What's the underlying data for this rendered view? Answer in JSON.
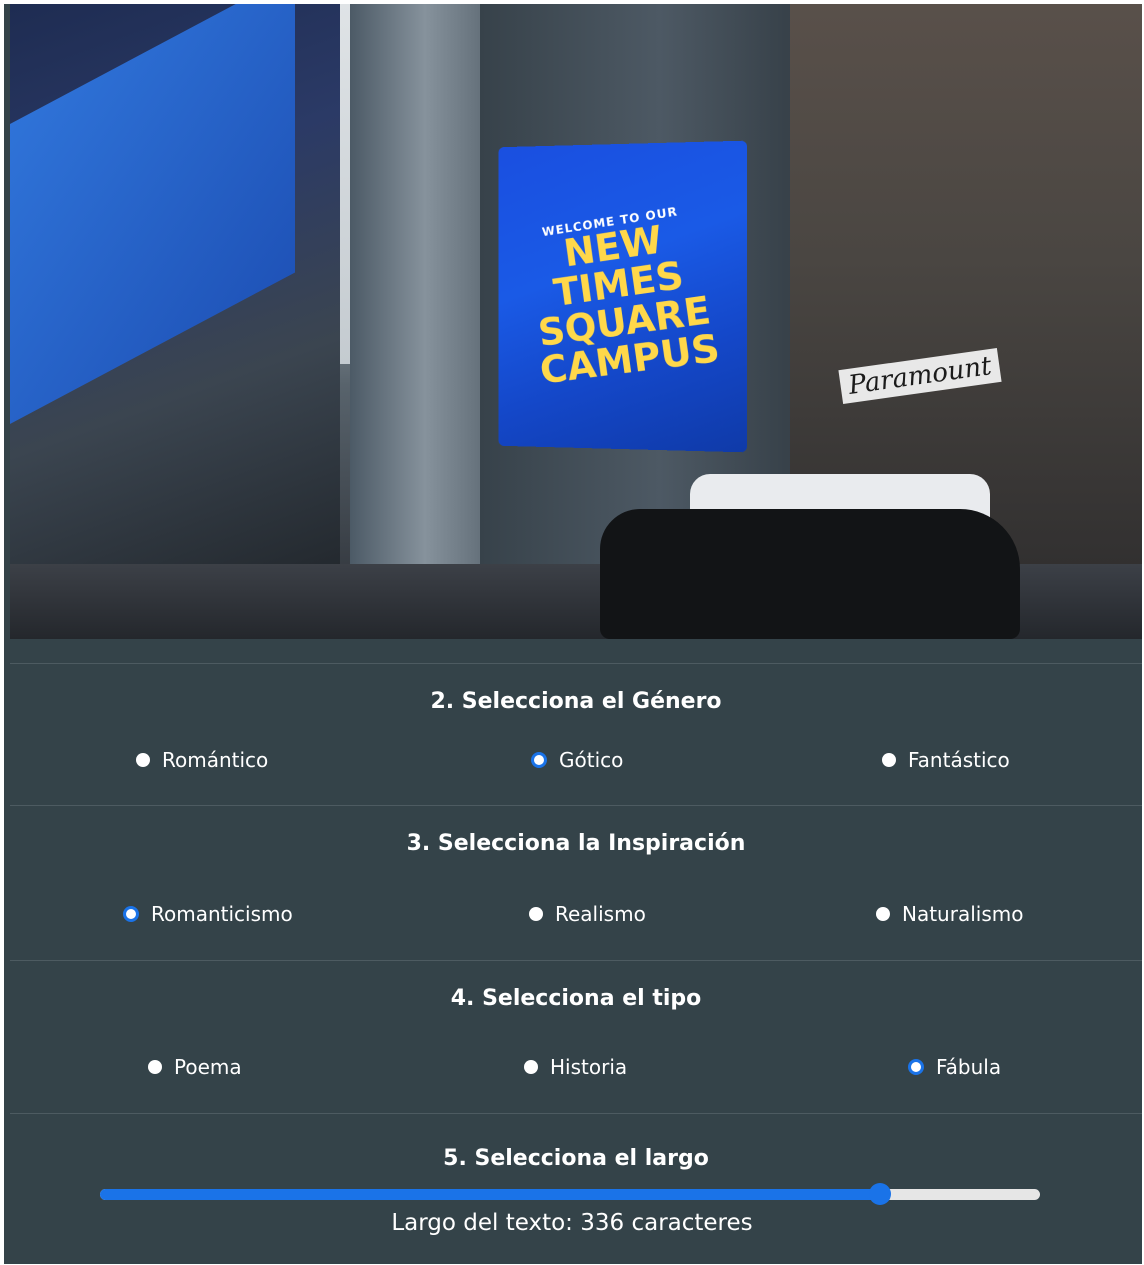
{
  "genre": {
    "title": "2. Selecciona el Género",
    "options": [
      "Romántico",
      "Gótico",
      "Fantástico"
    ],
    "selected": "Gótico"
  },
  "inspiration": {
    "title": "3. Selecciona la Inspiración",
    "options": [
      "Romanticismo",
      "Realismo",
      "Naturalismo"
    ],
    "selected": "Romanticismo"
  },
  "type": {
    "title": "4. Selecciona el tipo",
    "options": [
      "Poema",
      "Historia",
      "Fábula"
    ],
    "selected": "Fábula"
  },
  "length": {
    "title": "5. Selecciona el largo",
    "label": "Largo del texto: 336 caracteres",
    "value_fraction": 0.83
  },
  "photo": {
    "billboard_line1": "WELCOME TO OUR",
    "billboard_line2": "NEW",
    "billboard_line3": "TIMES",
    "billboard_line4": "SQUARE",
    "billboard_line5": "CAMPUS",
    "store_sign": "Paramount"
  },
  "colors": {
    "panel_bg": "#344349",
    "accent": "#1a73e8"
  }
}
